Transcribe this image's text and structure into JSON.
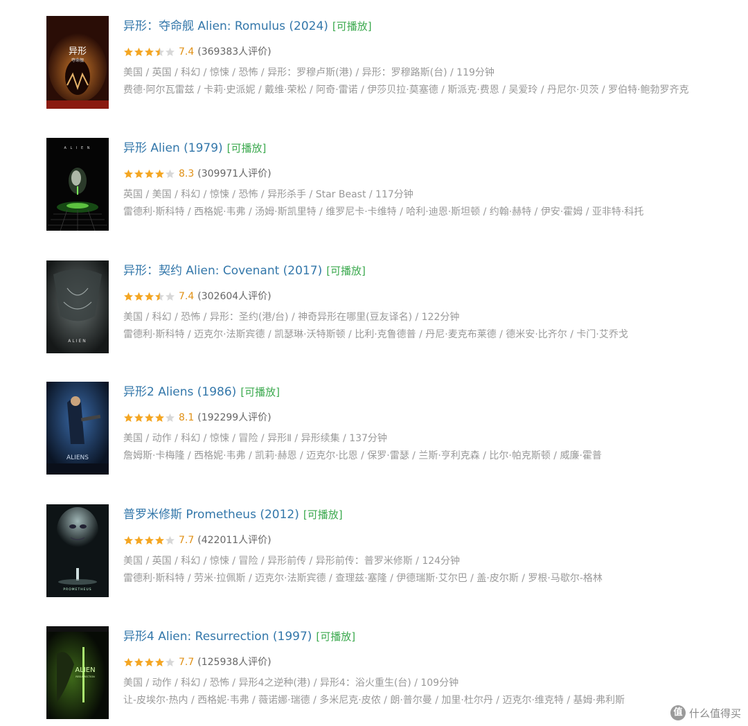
{
  "movies": [
    {
      "title": "异形：夺命舰 Alien: Romulus (2024)",
      "playable": "[可播放]",
      "stars": 3.5,
      "score": "7.4",
      "votes": "(369383人评价)",
      "meta": "美国 / 英国 / 科幻 / 惊悚 / 恐怖 / 异形：罗穆卢斯(港) / 异形：罗穆路斯(台) / 119分钟",
      "cast": "费德·阿尔瓦雷兹 / 卡莉·史派妮 / 戴维·荣松 / 阿奇·雷诺 / 伊莎贝拉·莫塞德 / 斯派克·费恩 / 吴爱玲 / 丹尼尔·贝茨 / 罗伯特·鲍勃罗齐克",
      "poster_text": "异形",
      "poster_sub": "夺命舰",
      "poster_theme": "romulus"
    },
    {
      "title": "异形 Alien (1979)",
      "playable": "[可播放]",
      "stars": 4,
      "score": "8.3",
      "votes": "(309971人评价)",
      "meta": "英国 / 美国 / 科幻 / 惊悚 / 恐怖 / 异形杀手 / Star Beast / 117分钟",
      "cast": "雷德利·斯科特 / 西格妮·韦弗 / 汤姆·斯凯里特 / 维罗尼卡·卡维特 / 哈利·迪恩·斯坦顿 / 约翰·赫特 / 伊安·霍姆 / 亚非特·科托",
      "poster_text": "A L I E N",
      "poster_sub": "",
      "poster_theme": "alien1979"
    },
    {
      "title": "异形：契约 Alien: Covenant (2017)",
      "playable": "[可播放]",
      "stars": 3.5,
      "score": "7.4",
      "votes": "(302604人评价)",
      "meta": "美国 / 科幻 / 恐怖 / 异形：圣约(港/台) / 神奇异形在哪里(豆友译名) / 122分钟",
      "cast": "雷德利·斯科特 / 迈克尔·法斯宾德 / 凯瑟琳·沃特斯顿 / 比利·克鲁德普 / 丹尼·麦克布莱德 / 德米安·比齐尔 / 卡门·艾乔戈",
      "poster_text": "ALIEN",
      "poster_sub": "",
      "poster_theme": "covenant"
    },
    {
      "title": "异形2 Aliens (1986)",
      "playable": "[可播放]",
      "stars": 4,
      "score": "8.1",
      "votes": "(192299人评价)",
      "meta": "美国 / 动作 / 科幻 / 惊悚 / 冒险 / 异形Ⅱ / 异形续集 / 137分钟",
      "cast": "詹姆斯·卡梅隆 / 西格妮·韦弗 / 凯莉·赫恩 / 迈克尔·比恩 / 保罗·雷瑟 / 兰斯·亨利克森 / 比尔·帕克斯顿 / 威廉·霍普",
      "poster_text": "ALIENS",
      "poster_sub": "",
      "poster_theme": "aliens"
    },
    {
      "title": "普罗米修斯 Prometheus (2012)",
      "playable": "[可播放]",
      "stars": 4,
      "score": "7.7",
      "votes": "(422011人评价)",
      "meta": "美国 / 英国 / 科幻 / 惊悚 / 冒险 / 异形前传 / 异形前传：普罗米修斯 / 124分钟",
      "cast": "雷德利·斯科特 / 劳米·拉佩斯 / 迈克尔·法斯宾德 / 查理兹·塞隆 / 伊德瑞斯·艾尔巴 / 盖·皮尔斯 / 罗根·马歇尔-格林",
      "poster_text": "PROMETHEUS",
      "poster_sub": "",
      "poster_theme": "prometheus"
    },
    {
      "title": "异形4 Alien: Resurrection (1997)",
      "playable": "[可播放]",
      "stars": 4,
      "score": "7.7",
      "votes": "(125938人评价)",
      "meta": "美国 / 动作 / 科幻 / 恐怖 / 异形4之逆种(港) / 异形4：浴火重生(台) / 109分钟",
      "cast": "让-皮埃尔·热内 / 西格妮·韦弗 / 薇诺娜·瑞德 / 多米尼克·皮侬 / 朗·普尔曼 / 加里·杜尔丹 / 迈克尔·维克特 / 基姆·弗利斯",
      "poster_text": "ALIEN",
      "poster_sub": "RESURRECTION",
      "poster_theme": "resurrection"
    }
  ],
  "watermark": {
    "text": "什么值得买",
    "icon": "值"
  },
  "colors": {
    "title": "#3377aa",
    "playable": "#3ba94e",
    "score": "#e09015",
    "star_on": "#f4a623",
    "star_off": "#d8d8d8",
    "meta": "#999999"
  }
}
